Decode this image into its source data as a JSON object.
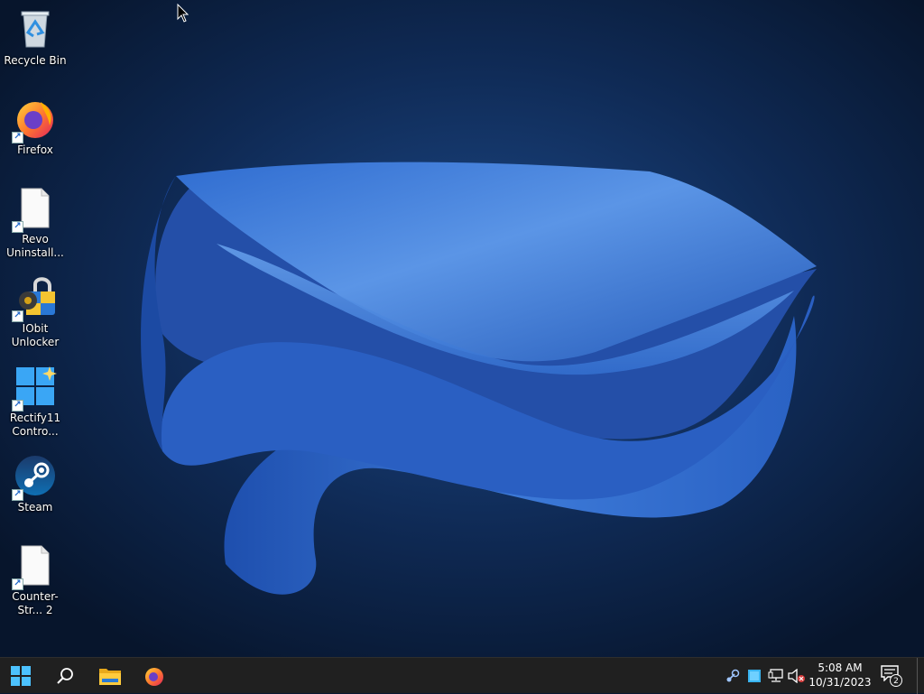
{
  "desktop_icons": [
    {
      "label": "Recycle Bin",
      "icon": "recycle-bin-icon"
    },
    {
      "label": "Firefox",
      "icon": "firefox-icon"
    },
    {
      "label": "Revo Uninstall...",
      "icon": "blank-file-icon"
    },
    {
      "label": "IObit Unlocker",
      "icon": "iobit-unlocker-icon"
    },
    {
      "label": "Rectify11 Contro...",
      "icon": "rectify11-icon"
    },
    {
      "label": "Steam",
      "icon": "steam-icon"
    },
    {
      "label": "Counter-Str... 2",
      "icon": "blank-file-icon"
    }
  ],
  "taskbar": {
    "pinned": [
      "start-icon",
      "search-icon",
      "file-explorer-icon",
      "firefox-icon"
    ],
    "tray_icons": [
      "steam-tray-icon",
      "app-tray-icon",
      "network-icon",
      "volume-muted-icon"
    ],
    "clock": {
      "time": "5:08 AM",
      "date": "10/31/2023"
    },
    "notification_count": "2"
  },
  "colors": {
    "taskbar_bg": "#202020",
    "wallpaper_dark": "#0a1a33",
    "bloom_blue": "#3a7ad8",
    "accent": "#2f8fe0"
  }
}
